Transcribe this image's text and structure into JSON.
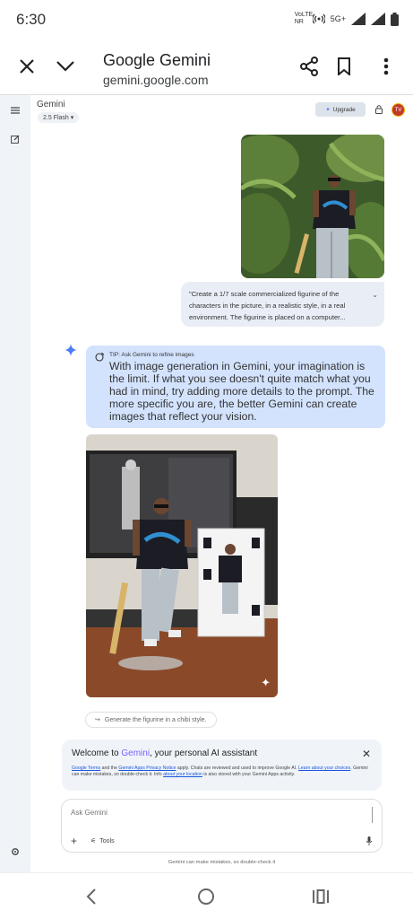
{
  "status": {
    "time": "6:30",
    "network_label": "VoLTE NR",
    "five_g": "5G+"
  },
  "browser": {
    "title": "Google Gemini",
    "url": "gemini.google.com",
    "close_icon": "close-icon",
    "collapse_icon": "chevron-down-icon",
    "share_icon": "share-icon",
    "bookmark_icon": "bookmark-icon",
    "menu_icon": "more-vert-icon"
  },
  "header": {
    "app_name": "Gemini",
    "model": "2.5 Flash",
    "upgrade_label": "Upgrade",
    "avatar_initials": "TV"
  },
  "chat": {
    "prompt_text": "\"Create a 1/7 scale commercialized figurine of the characters in the picture, in a realistic style, in a real environment. The figurine is placed on a computer...",
    "tip_heading": "TIP: Ask Gemini to refine images",
    "tip_body": "With image generation in Gemini, your imagination is the limit. If what you see doesn't quite match what you had in mind, try adding more details to the prompt. The more specific you are, the better Gemini can create images that reflect your vision.",
    "suggestion": "Generate the figurine in a chibi style."
  },
  "welcome": {
    "title_pre": "Welcome to ",
    "title_brand": "Gemini",
    "title_post": ", your personal AI assistant",
    "terms_link": "Google Terms",
    "and_text": " and the ",
    "privacy_link": "Gemini Apps Privacy Notice",
    "apply_text": " apply. Chats are reviewed and used to improve Google AI. ",
    "learn_link": "Learn about your choices",
    "mistakes_text": ". Gemini can make mistakes, so double-check it. Info ",
    "location_link": "about your location",
    "stored_text": " is also stored with your Gemini Apps activity."
  },
  "input": {
    "placeholder": "Ask Gemini",
    "tools_label": "Tools"
  },
  "disclaimer": "Gemini can make mistakes, so double-check it",
  "colors": {
    "accent": "#7b61ff",
    "tip_bg": "#d3e3fd",
    "bubble_bg": "#e9eef6",
    "sidebar_bg": "#f0f4f9"
  }
}
